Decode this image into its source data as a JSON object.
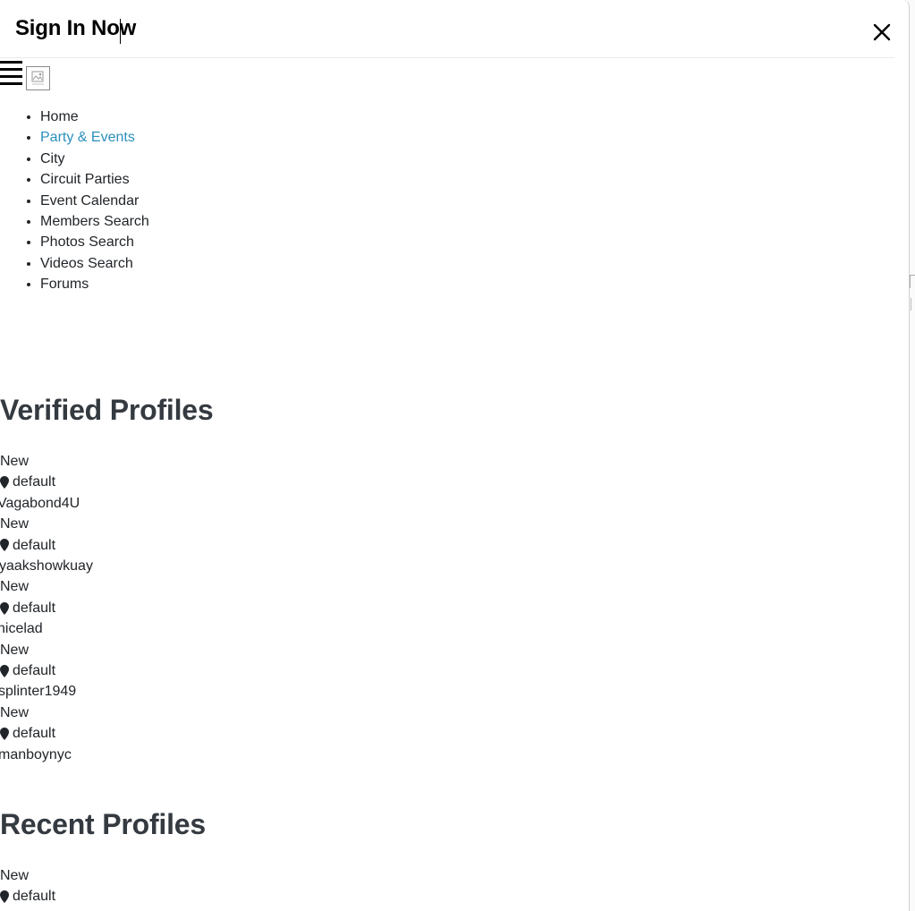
{
  "modal": {
    "title": "Sign In Now",
    "close_icon": "close-icon"
  },
  "header_icons": {
    "menu": "hamburger-menu-icon",
    "logo": "broken-image-icon"
  },
  "nav": {
    "items": [
      {
        "label": "Home"
      },
      {
        "label": "Party & Events"
      },
      {
        "label": "City"
      },
      {
        "label": "Circuit Parties"
      },
      {
        "label": "Event Calendar"
      },
      {
        "label": "Members Search"
      },
      {
        "label": "Photos Search"
      },
      {
        "label": "Videos Search"
      },
      {
        "label": "Forums"
      }
    ],
    "active_color": "#2a8fbd"
  },
  "verified": {
    "heading": "Verified Profiles",
    "profiles": [
      {
        "badge": "New",
        "location": "default",
        "username": "Vagabond4U"
      },
      {
        "badge": "New",
        "location": "default",
        "username": "yaakshowkuay"
      },
      {
        "badge": "New",
        "location": "default",
        "username": "nicelad"
      },
      {
        "badge": "New",
        "location": "default",
        "username": "splinter1949"
      },
      {
        "badge": "New",
        "location": "default",
        "username": "manboynyc"
      }
    ]
  },
  "recent": {
    "heading": "Recent Profiles",
    "profiles": [
      {
        "badge": "New",
        "location": "default"
      }
    ]
  },
  "colors": {
    "heading": "#343a40",
    "text": "#212529"
  }
}
